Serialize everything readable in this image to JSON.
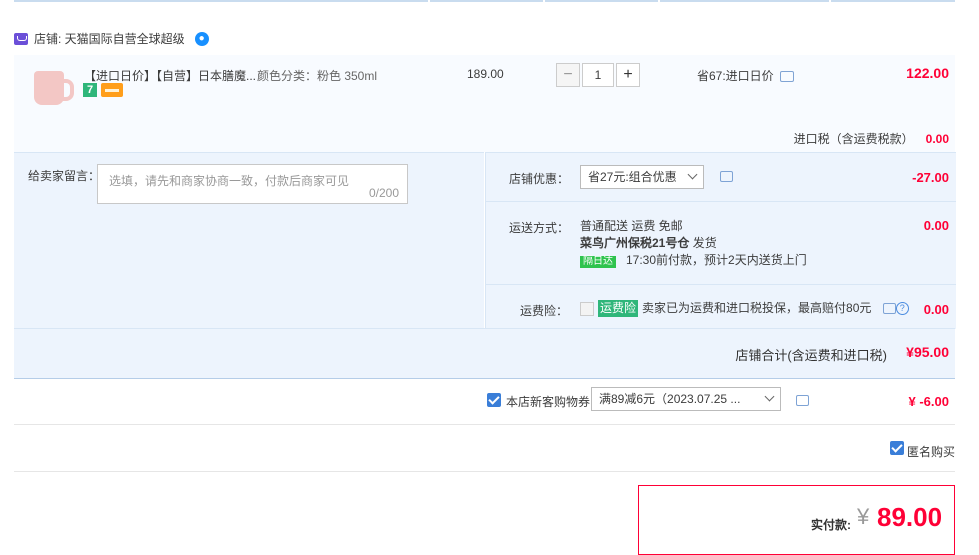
{
  "shop": {
    "label": "店铺: 天猫国际自营全球超级"
  },
  "item": {
    "title": "【进口日价】【自营】日本膳魔...",
    "spec": "颜色分类：粉色 350ml",
    "unit_price": "189.00",
    "quantity": "1",
    "minus": "−",
    "plus": "+",
    "saving": "省67:进口日价",
    "subtotal": "122.00",
    "tag_seven": "7",
    "import_tax_label": "进口税（含运费税款）",
    "import_tax_value": "0.00"
  },
  "message": {
    "label": "给卖家留言：",
    "placeholder": "选填，请先和商家协商一致，付款后商家可见",
    "counter": "0/200"
  },
  "discount": {
    "label": "店铺优惠：",
    "selected": "省27元:组合优惠",
    "value": "-27.00"
  },
  "shipping": {
    "label": "运送方式：",
    "method": "普通配送 运费 免邮",
    "warehouse": "菜鸟广州保税21号仓",
    "warehouse_suffix": "发货",
    "next_day_tag": "隔日达",
    "eta": "17:30前付款，预计2天内送货上门",
    "value": "0.00"
  },
  "insurance": {
    "label": "运费险：",
    "tag": "运费险",
    "text": "卖家已为运费和进口税投保，最高赔付80元",
    "help": "?",
    "value": "0.00"
  },
  "shop_total": {
    "label": "店铺合计(含运费和进口税)",
    "value": "¥95.00"
  },
  "coupon": {
    "label": "本店新客购物券",
    "selected": "满89减6元（2023.07.25 ...",
    "value": "¥ -6.00"
  },
  "anonymous": {
    "label": "匿名购买"
  },
  "payment": {
    "label": "实付款:",
    "currency": "¥",
    "value": "89.00"
  },
  "colors": {
    "accent_red": "#ff0036",
    "panel_blue": "#edf4fd",
    "checkbox_blue": "#3a7ed8"
  }
}
